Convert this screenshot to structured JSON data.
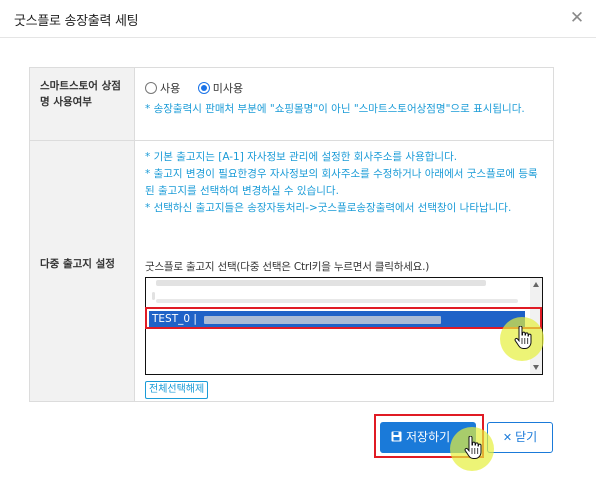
{
  "dialog": {
    "title": "굿스플로 송장출력 세팅",
    "close_glyph": "✕"
  },
  "row_store_name": {
    "label": "스마트스토어 상점명 사용여부",
    "radio_options": [
      {
        "label": "사용",
        "checked": false
      },
      {
        "label": "미사용",
        "checked": true
      }
    ],
    "note": "* 송장출력시 판매처 부분에 \"쇼핑몰명\"이 아닌 \"스마트스토어상점명\"으로 표시됩니다."
  },
  "row_warehouse": {
    "label": "다중 출고지 설정",
    "notes": [
      "* 기본 출고지는 [A-1] 자사정보 관리에 설정한 회사주소를 사용합니다.",
      "* 출고지 변경이 필요한경우 자사정보의 회사주소를 수정하거나 아래에서 굿스플로에 등록된 출고지를 선택하여 변경하실 수 있습니다.",
      "* 선택하신 출고지들은 송장자동처리->굿스플로송장출력에서 선택창이 나타납니다."
    ],
    "select_label": "굿스플로 출고지 선택(다중 선택은 Ctrl키을 누르면서 클릭하세요.)",
    "listbox": {
      "selected_option": "TEST_0 |"
    },
    "deselect_all_label": "전체선택해제"
  },
  "footer": {
    "save_label": "저장하기",
    "close_label": "닫기",
    "save_icon": "floppy-disk-icon",
    "close_icon": "x-icon"
  },
  "colors": {
    "primary": "#1a7ad9",
    "note_text": "#1a9bd7",
    "selected_row": "#1f62c7",
    "annotation_red": "#e01b24",
    "cursor_highlight": "#e6f03c"
  }
}
